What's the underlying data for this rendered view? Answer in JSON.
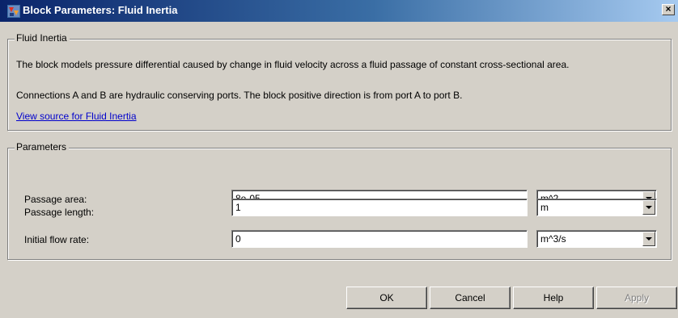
{
  "window": {
    "title": "Block Parameters: Fluid Inertia",
    "close_label": "×"
  },
  "description_group": {
    "legend": "Fluid Inertia",
    "line1": "The block models pressure differential caused by change in fluid velocity across a fluid passage of constant cross-sectional area.",
    "line2": "Connections A and B are hydraulic conserving ports. The block positive direction is from port A to port B.",
    "source_link": "View source for Fluid Inertia"
  },
  "parameters_group": {
    "legend": "Parameters",
    "rows": [
      {
        "label": "Passage area:",
        "value": "8e-05",
        "unit": "m^2"
      },
      {
        "label": "Passage length:",
        "value": "1",
        "unit": "m"
      },
      {
        "label": "Initial flow rate:",
        "value": "0",
        "unit": "m^3/s"
      }
    ]
  },
  "buttons": {
    "ok": "OK",
    "cancel": "Cancel",
    "help": "Help",
    "apply": "Apply"
  },
  "icons": {
    "app": "simulink-block-icon",
    "close": "close-icon",
    "dropdown": "chevron-down-icon"
  },
  "colors": {
    "titlebar_start": "#0a246a",
    "titlebar_end": "#a6caf0",
    "face": "#d4d0c8",
    "link": "#0000cc"
  }
}
